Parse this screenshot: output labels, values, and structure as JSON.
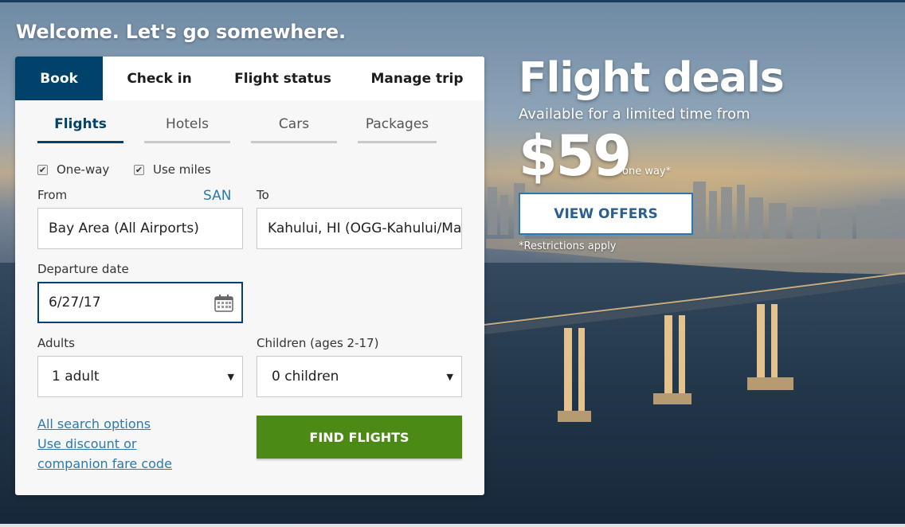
{
  "welcome": "Welcome. Let's go somewhere.",
  "main_tabs": [
    {
      "label": "Book",
      "active": true
    },
    {
      "label": "Check in",
      "active": false
    },
    {
      "label": "Flight status",
      "active": false
    },
    {
      "label": "Manage trip",
      "active": false
    }
  ],
  "sub_tabs": [
    {
      "label": "Flights",
      "active": true
    },
    {
      "label": "Hotels",
      "active": false
    },
    {
      "label": "Cars",
      "active": false
    },
    {
      "label": "Packages",
      "active": false
    }
  ],
  "options": {
    "one_way": {
      "label": "One-way",
      "checked": true
    },
    "use_miles": {
      "label": "Use miles",
      "checked": true
    }
  },
  "from": {
    "label": "From",
    "code": "SAN",
    "value": "Bay Area (All Airports)"
  },
  "to": {
    "label": "To",
    "value": "Kahului, HI (OGG-Kahului/Maui)"
  },
  "departure": {
    "label": "Departure date",
    "value": "6/27/17",
    "icon": "calendar-icon"
  },
  "adults": {
    "label": "Adults",
    "value": "1 adult"
  },
  "children": {
    "label": "Children (ages 2-17)",
    "value": "0 children"
  },
  "links": {
    "all_search": "All search options",
    "discount_line1": "Use discount or",
    "discount_line2": "companion fare code"
  },
  "find_button": "FIND FLIGHTS",
  "deals": {
    "title": "Flight deals",
    "subtitle": "Available for a limited time from",
    "price": "$59",
    "price_suffix": "one way*",
    "button": "VIEW OFFERS",
    "note": "*Restrictions apply"
  },
  "colors": {
    "brand_navy": "#01426a",
    "find_green": "#4b8a15",
    "link_blue": "#2a7ab0"
  }
}
